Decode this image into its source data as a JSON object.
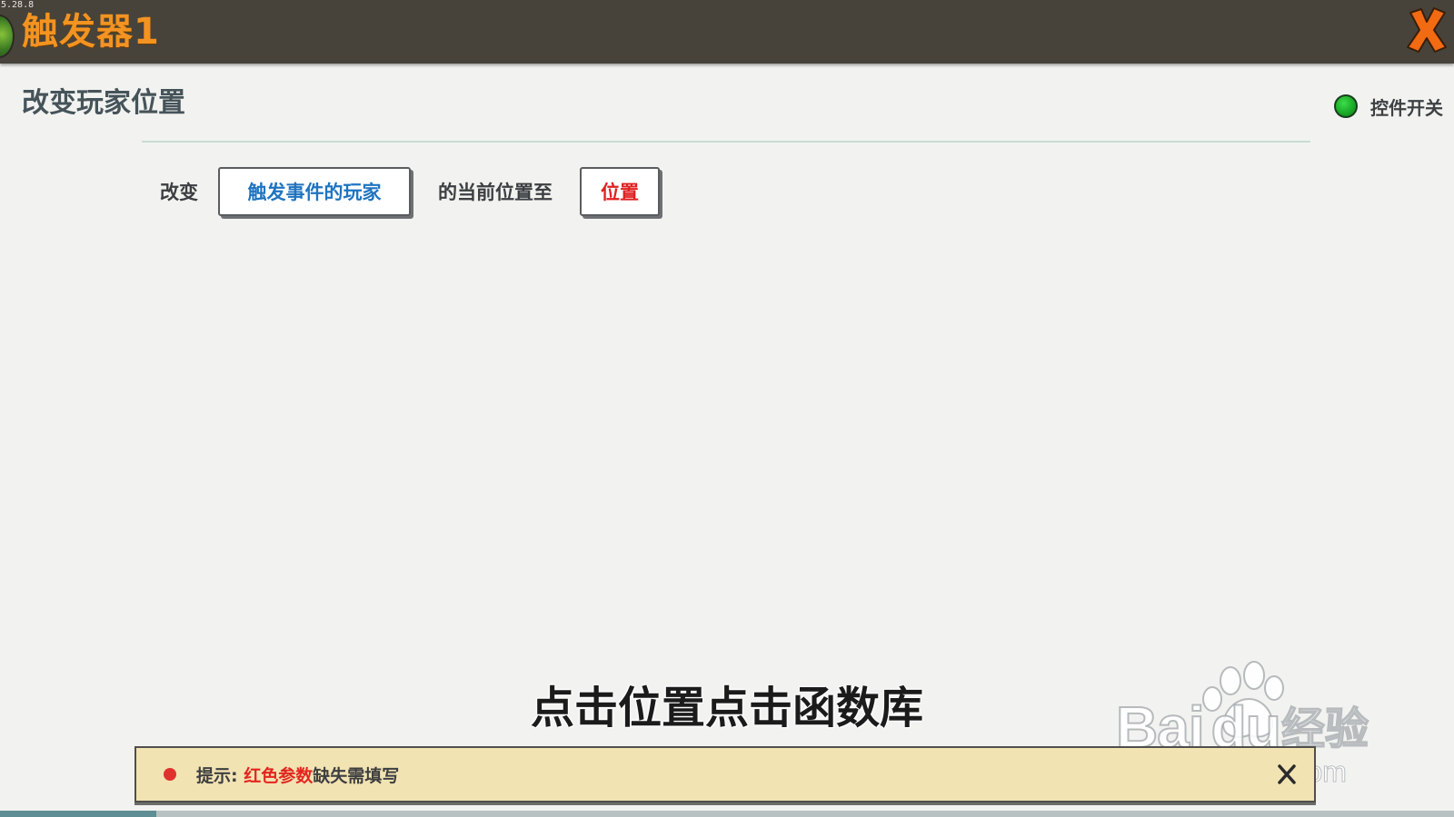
{
  "window": {
    "version": "5.28.8",
    "title": "触发器1"
  },
  "header": {
    "section_title": "改变玩家位置",
    "toggle_label": "控件开关",
    "toggle_state": "on",
    "toggle_color": "#17a625"
  },
  "action": {
    "prefix": "改变",
    "target_param": "触发事件的玩家",
    "middle": "的当前位置至",
    "position_param": "位置",
    "target_param_color": "#1f74c0",
    "position_param_color": "#e02020"
  },
  "subtitle": "点击位置点击函数库",
  "hint": {
    "label": "提示: ",
    "red_part": "红色参数",
    "rest": "缺失需填写",
    "close_icon": "close-icon"
  },
  "watermark": {
    "brand": "Bai",
    "brand_suffix": "du",
    "cn": "经验",
    "url": "jingyan.baidu.com"
  },
  "colors": {
    "titlebar": "#47433a",
    "title_accent": "#f39321",
    "close_accent": "#f26a12",
    "hint_bg": "#f2e3b3"
  }
}
